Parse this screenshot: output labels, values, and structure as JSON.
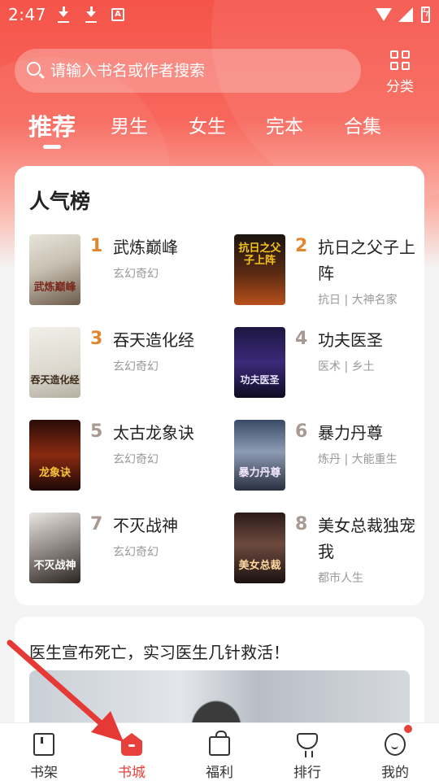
{
  "status_bar": {
    "time": "2:47",
    "icons": [
      "download-icon",
      "download-icon",
      "a-notification-icon",
      "wifi-icon",
      "signal-icon",
      "battery-charging-icon"
    ]
  },
  "search": {
    "placeholder": "请输入书名或作者搜索",
    "icon": "search-icon"
  },
  "category_button": {
    "label": "分类",
    "icon": "grid-icon"
  },
  "tabs": [
    {
      "label": "推荐",
      "active": true
    },
    {
      "label": "男生",
      "active": false
    },
    {
      "label": "女生",
      "active": false
    },
    {
      "label": "完本",
      "active": false
    },
    {
      "label": "合集",
      "active": false
    }
  ],
  "ranking": {
    "title": "人气榜",
    "books": [
      {
        "rank": "1",
        "name": "武炼巅峰",
        "tag": "玄幻奇幻",
        "cover_text": "武炼巅峰"
      },
      {
        "rank": "2",
        "name": "抗日之父子上阵",
        "tag": "抗日 | 大神名家",
        "cover_text": "抗日之父子上阵"
      },
      {
        "rank": "3",
        "name": "吞天造化经",
        "tag": "玄幻奇幻",
        "cover_text": "吞天造化经"
      },
      {
        "rank": "4",
        "name": "功夫医圣",
        "tag": "医术 | 乡土",
        "cover_text": "功夫医圣"
      },
      {
        "rank": "5",
        "name": "太古龙象诀",
        "tag": "玄幻奇幻",
        "cover_text": "龙象诀"
      },
      {
        "rank": "6",
        "name": "暴力丹尊",
        "tag": "炼丹 | 大能重生",
        "cover_text": "暴力丹尊"
      },
      {
        "rank": "7",
        "name": "不灭战神",
        "tag": "玄幻奇幻",
        "cover_text": "不灭战神"
      },
      {
        "rank": "8",
        "name": "美女总裁独宠我",
        "tag": "都市人生",
        "cover_text": "美女总裁"
      }
    ],
    "rank_colors": {
      "top3": "#e0862d",
      "rest": "#a89a92"
    }
  },
  "article": {
    "headline": "医生宣布死亡，实习医生几针救活！"
  },
  "bottom_nav": [
    {
      "label": "书架",
      "icon": "bookshelf-icon",
      "active": false
    },
    {
      "label": "书城",
      "icon": "bookstore-home-icon",
      "active": true
    },
    {
      "label": "福利",
      "icon": "gift-icon",
      "active": false
    },
    {
      "label": "排行",
      "icon": "trophy-icon",
      "active": false
    },
    {
      "label": "我的",
      "icon": "profile-icon",
      "active": false,
      "badge": true
    }
  ],
  "colors": {
    "accent": "#e8413b",
    "header_red": "#f5544a"
  }
}
